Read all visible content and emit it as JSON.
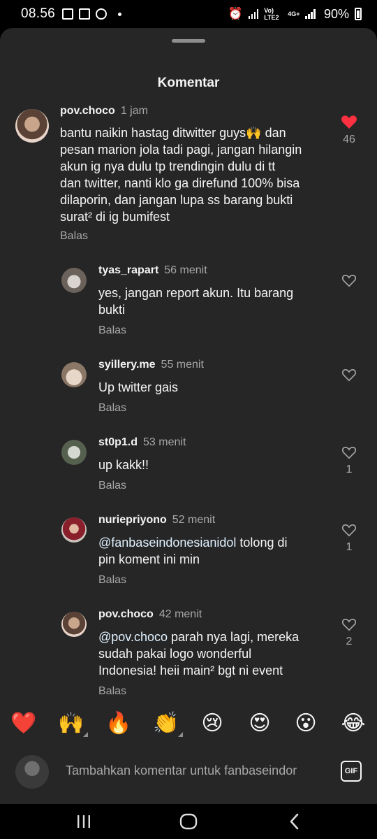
{
  "status_bar": {
    "time": "08.56",
    "network_label": "Vo) LTE2",
    "network_type": "4G+",
    "battery": "90%"
  },
  "sheet": {
    "title": "Komentar"
  },
  "comments": [
    {
      "username": "pov.choco",
      "time": "1 jam",
      "text": "bantu naikin hastag ditwitter guys🙌 dan pesan marion jola tadi pagi, jangan hilangin akun ig nya dulu tp trendingin dulu di tt dan twitter, nanti klo ga direfund 100% bisa dilaporin, dan jangan lupa ss barang bukti surat² di ig bumifest",
      "text_lines": [
        "bantu naikin hastag ditwitter guys🙌 dan",
        "pesan marion jola tadi pagi, jangan hilangin",
        "akun ig nya dulu tp trendingin dulu di tt",
        "dan twitter, nanti klo ga direfund 100% bisa",
        "dilaporin, dan jangan lupa ss barang bukti",
        "surat² di ig bumifest"
      ],
      "reply": "Balas",
      "likes": "46",
      "liked": true
    },
    {
      "username": "tyas_rapart",
      "time": "56 menit",
      "text_lines": [
        "yes, jangan report akun. Itu barang",
        "bukti"
      ],
      "reply": "Balas",
      "likes": ""
    },
    {
      "username": "syillery.me",
      "time": "55 menit",
      "text_lines": [
        "Up twitter gais"
      ],
      "reply": "Balas",
      "likes": ""
    },
    {
      "username": "st0p1.d",
      "time": "53 menit",
      "text_lines": [
        "up kakk!!"
      ],
      "reply": "Balas",
      "likes": "1"
    },
    {
      "username": "nuriepriyono",
      "time": "52 menit",
      "mention": "@fanbaseindonesianidol",
      "text_lines": [
        " tolong di",
        "pin koment ini min"
      ],
      "reply": "Balas",
      "likes": "1"
    },
    {
      "username": "pov.choco",
      "time": "42 menit",
      "mention": "@pov.choco",
      "text_lines": [
        " parah nya lagi, mereka",
        "sudah pakai logo wonderful",
        "Indonesia! heii main² bgt ni event"
      ],
      "reply": "Balas",
      "likes": "2"
    }
  ],
  "emoji_bar": [
    "❤️",
    "🙌",
    "🔥",
    "👏",
    "😢",
    "😍",
    "😮",
    "😂"
  ],
  "input": {
    "placeholder": "Tambahkan komentar untuk fanbaseindor",
    "gif_label": "GIF"
  },
  "colors": {
    "sheet_bg": "#262626",
    "heart_red": "#ff3040",
    "secondary_text": "#a8a8a8",
    "mention": "#e0f1ff"
  }
}
